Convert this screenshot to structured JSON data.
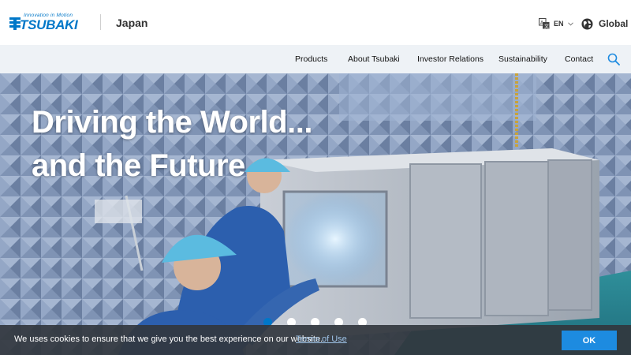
{
  "header": {
    "logo": {
      "tagline": "Innovation in Motion",
      "wordmark": "TSUBAKI",
      "color": "#0077c8"
    },
    "region": "Japan",
    "language": {
      "label": "EN",
      "icon": "translate-icon"
    },
    "global": {
      "label": "Global",
      "icon": "globe-icon"
    }
  },
  "nav": {
    "items": [
      {
        "label": "Products"
      },
      {
        "label": "About Tsubaki"
      },
      {
        "label": "Investor Relations"
      },
      {
        "label": "Sustainability"
      },
      {
        "label": "Contact"
      }
    ],
    "search_icon": "search-icon"
  },
  "hero": {
    "headline_line1": "Driving the World...",
    "headline_line2": "and the Future",
    "slide_count": 5,
    "active_slide": 1
  },
  "cookie": {
    "text": "We uses cookies to ensure that we give you the best experience on our website.",
    "link": "Terms of Use",
    "button": "OK",
    "button_color": "#1d8be0"
  }
}
